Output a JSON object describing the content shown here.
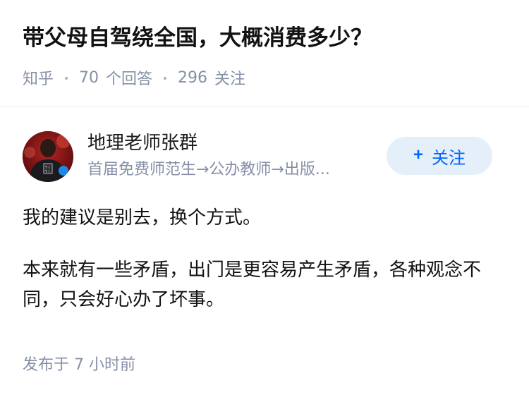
{
  "question": {
    "title": "带父母自驾绕全国，大概消费多少？",
    "source": "知乎",
    "answers_count": "70",
    "answers_label": "个回答",
    "followers_count": "296",
    "followers_label": "关注"
  },
  "author": {
    "name": "地理老师张群",
    "bio": "首届免费师范生→公办教师→出版...",
    "follow_label": "关注",
    "avatar_icon": "person-avatar-icon"
  },
  "answer": {
    "paragraphs": [
      "我的建议是别去，换个方式。",
      "本来就有一些矛盾，出门是更容易产生矛盾，各种观念不同，只会好心办了坏事。"
    ],
    "published": "发布于 7 小时前"
  },
  "colors": {
    "accent": "#0066ff",
    "follow_bg": "#e5eff9",
    "meta_text": "#8590a6",
    "title_text": "#121212"
  }
}
